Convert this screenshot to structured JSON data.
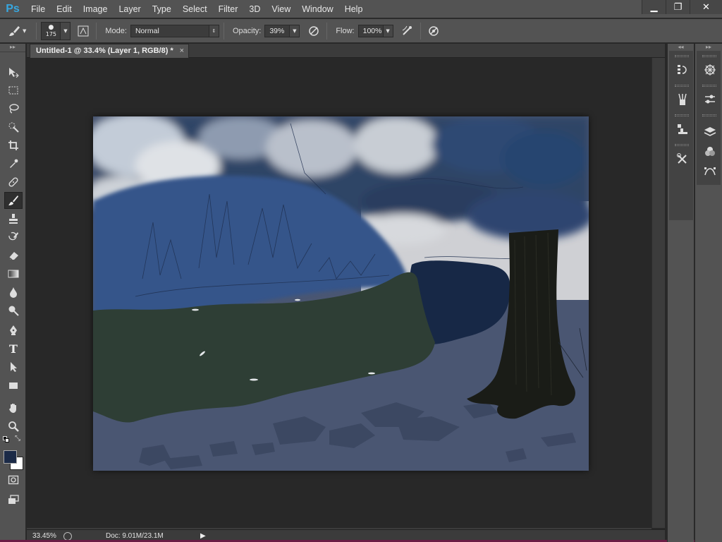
{
  "app": {
    "logo": "Ps"
  },
  "menu": [
    "File",
    "Edit",
    "Image",
    "Layer",
    "Type",
    "Select",
    "Filter",
    "3D",
    "View",
    "Window",
    "Help"
  ],
  "window_controls": {
    "minimize": "▁",
    "restore": "❐",
    "close": "✕"
  },
  "options": {
    "brush_size": "175",
    "mode_label": "Mode:",
    "mode_value": "Normal",
    "opacity_label": "Opacity:",
    "opacity_value": "39%",
    "flow_label": "Flow:",
    "flow_value": "100%"
  },
  "document": {
    "tab_title": "Untitled-1 @ 33.4% (Layer 1, RGB/8) *",
    "tab_close": "×"
  },
  "status": {
    "zoom": "33.45%",
    "doc_info": "Doc: 9.01M/23.1M",
    "arrow": "▶"
  },
  "colors": {
    "foreground": "#1b2a47",
    "background": "#ffffff",
    "accent": "#37a7e0"
  },
  "tools": [
    "move-tool",
    "marquee-tool",
    "lasso-tool",
    "quick-selection-tool",
    "crop-tool",
    "eyedropper-tool",
    "healing-brush-tool",
    "brush-tool",
    "clone-stamp-tool",
    "history-brush-tool",
    "eraser-tool",
    "gradient-tool",
    "blur-tool",
    "dodge-tool",
    "pen-tool",
    "type-tool",
    "path-selection-tool",
    "rectangle-tool",
    "hand-tool",
    "zoom-tool",
    "quick-mask",
    "screen-mode"
  ],
  "tool_text": {
    "type_tool": "T"
  },
  "panels_dock1": [
    "history-icon",
    "brush-presets-icon",
    "clone-source-icon",
    "tool-presets-icon"
  ],
  "panels_dock2": [
    "navigator-icon",
    "adjustments-icon",
    "layers-icon",
    "channels-icon",
    "paths-icon"
  ]
}
